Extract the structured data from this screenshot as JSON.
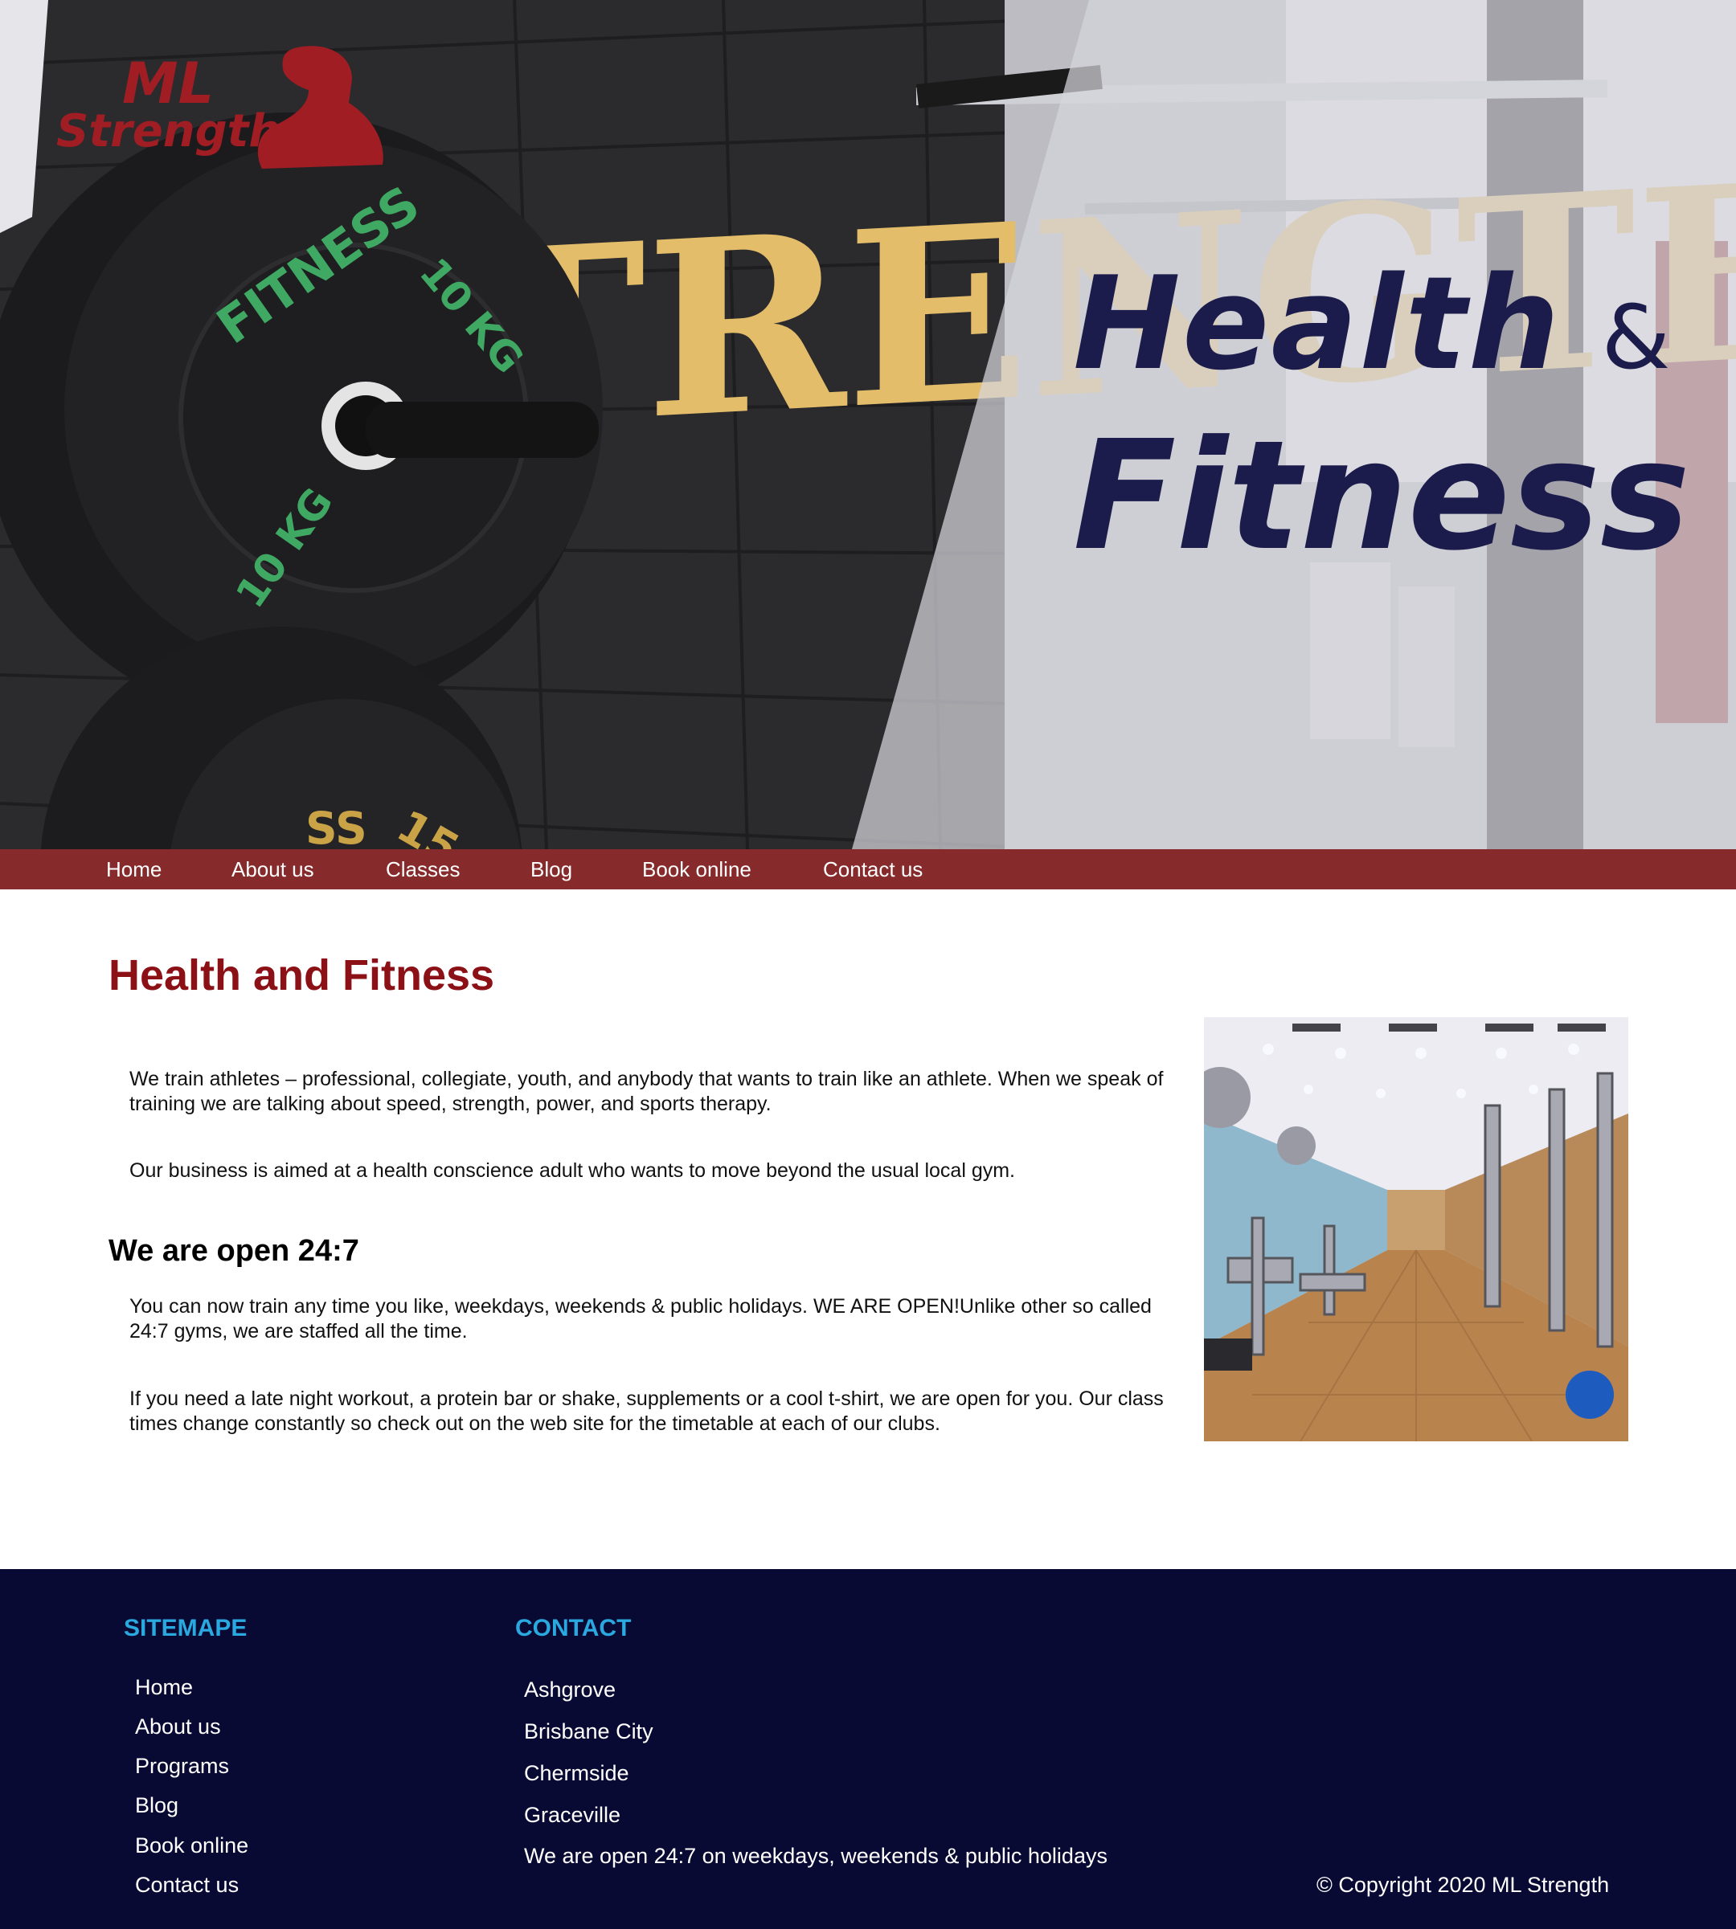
{
  "hero": {
    "title_line1": "Health",
    "title_amp": "&",
    "title_line2": "Fitness",
    "logo_text_1": "ML",
    "logo_text_2": "Strength",
    "wall_text": "TRENGTH",
    "plate_text": "FITNESS",
    "plate_weight": "10 KG"
  },
  "nav": {
    "items": [
      "Home",
      "About us",
      "Classes",
      "Blog",
      "Book online",
      "Contact us"
    ]
  },
  "main": {
    "title": "Health and Fitness",
    "p1": "We train athletes – professional, collegiate, youth, and anybody that wants to train like an athlete. When we speak of training we are talking about speed, strength, power, and sports therapy.",
    "p2": "Our business is aimed at a health conscience adult who wants to move beyond the usual local gym.",
    "subtitle": "We are open 24:7",
    "p3": "You can now train any time you like, weekdays, weekends & public holidays. WE ARE OPEN!Unlike other so called 24:7 gyms, we are staffed all the time.",
    "p4": "If you need a late night workout, a protein bar or shake, supplements or a cool t-shirt, we are open for you. Our class times change constantly so check out on the web site for the timetable at each of our clubs."
  },
  "footer": {
    "sitemap_title": "SITEMAPE",
    "sitemap_links": [
      "Home",
      "About us",
      "Programs",
      "Blog",
      "Book online",
      "Contact us"
    ],
    "contact_title": "CONTACT",
    "contact_items": [
      "Ashgrove",
      "Brisbane City",
      "Chermside",
      "Graceville"
    ],
    "hours": "We are open 24:7 on weekdays, weekends & public holidays",
    "copyright": "© Copyright 2020 ML Strength"
  },
  "colors": {
    "nav_bg": "#862a2b",
    "title_red": "#8c1116",
    "hero_title": "#1c1c4c",
    "footer_bg": "#090a33",
    "footer_heading": "#2aa8e0"
  }
}
